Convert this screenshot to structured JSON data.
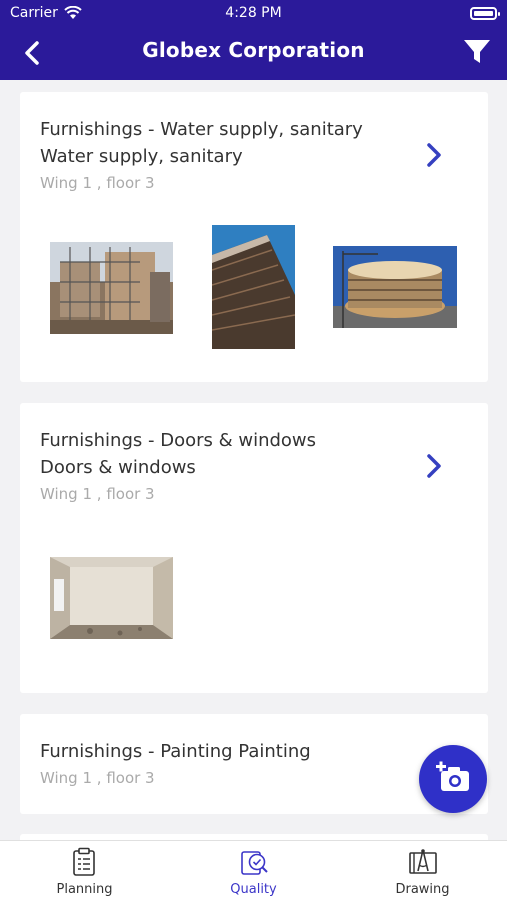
{
  "status_bar": {
    "carrier": "Carrier",
    "time": "4:28 PM"
  },
  "header": {
    "title": "Globex Corporation"
  },
  "items": [
    {
      "title_line1": "Furnishings - Water supply, sanitary",
      "title_line2": "Water supply, sanitary",
      "location": "Wing 1 , floor 3",
      "photos": 3
    },
    {
      "title_line1": "Furnishings - Doors & windows",
      "title_line2": "Doors & windows",
      "location": "Wing 1 , floor 3",
      "photos": 1
    },
    {
      "title_line1": "Furnishings - Painting Painting",
      "location": "Wing 1 , floor 3"
    }
  ],
  "tabs": [
    {
      "label": "Planning",
      "icon": "clipboard-icon"
    },
    {
      "label": "Quality",
      "icon": "quality-check-icon",
      "active": true
    },
    {
      "label": "Drawing",
      "icon": "drawing-compass-icon"
    }
  ],
  "colors": {
    "primary": "#2b1a9a",
    "accent": "#2f30c8",
    "active_tab": "#3c36c8"
  }
}
